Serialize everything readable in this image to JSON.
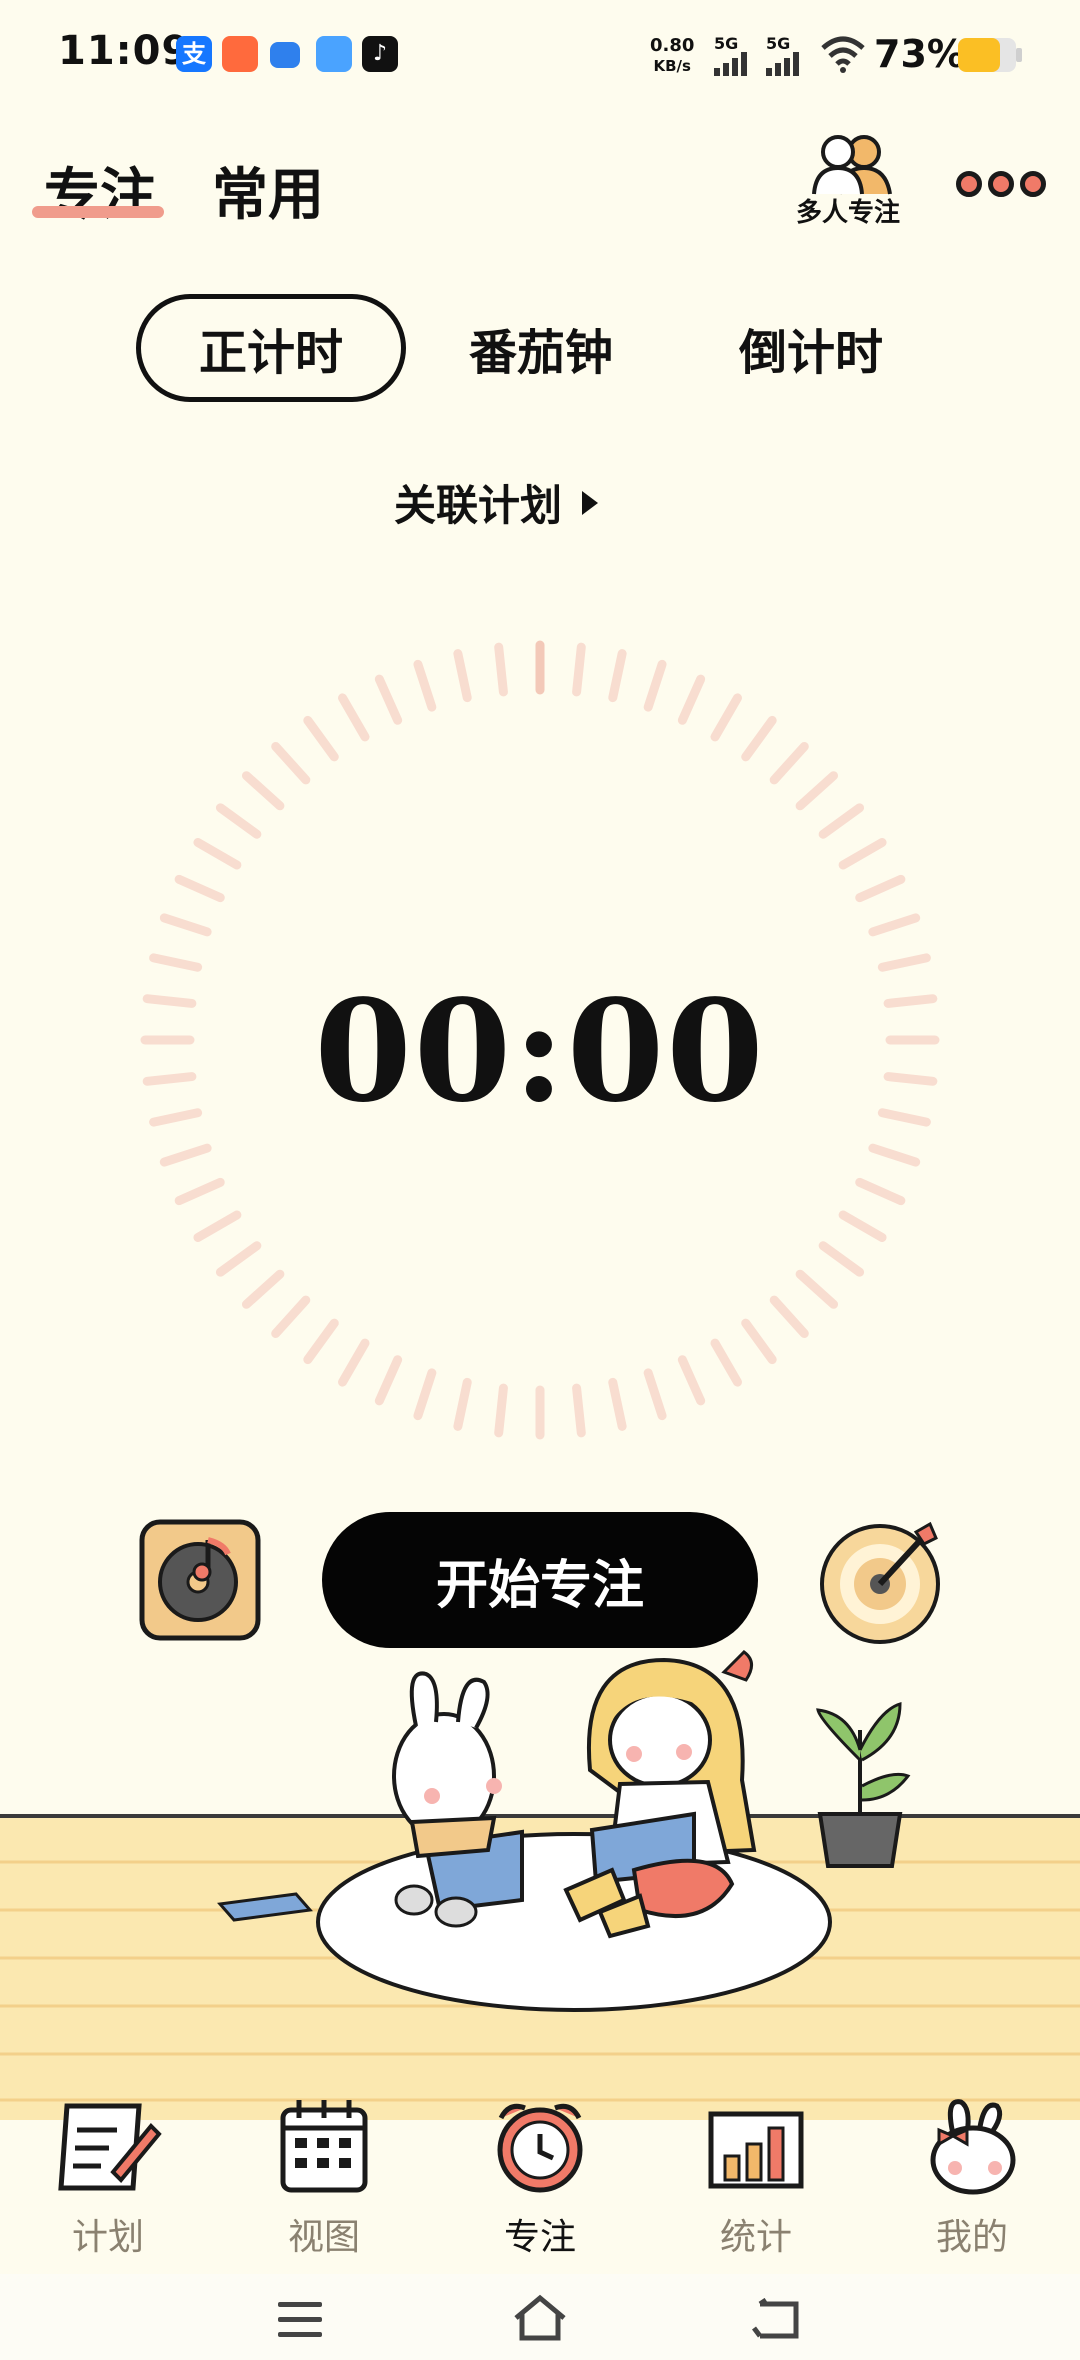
{
  "status_bar": {
    "time": "11:09",
    "net_speed_value": "0.80",
    "net_speed_unit": "KB/s",
    "signal_1": "5G",
    "signal_2": "5G",
    "battery": "73%",
    "icons": [
      "alipay-icon",
      "app-icon",
      "message-icon",
      "cloud-icon",
      "tiktok-icon"
    ]
  },
  "header": {
    "tab_focus": "专注",
    "tab_common": "常用",
    "multi_focus": "多人专注"
  },
  "modes": [
    "正计时",
    "番茄钟",
    "倒计时"
  ],
  "link_plan": "关联计划",
  "timer": "00:00",
  "start_button": "开始专注",
  "bottom_nav": [
    {
      "label": "计划",
      "icon": "notepad-icon"
    },
    {
      "label": "视图",
      "icon": "calendar-icon"
    },
    {
      "label": "专注",
      "icon": "alarm-clock-icon"
    },
    {
      "label": "统计",
      "icon": "bar-chart-icon"
    },
    {
      "label": "我的",
      "icon": "bunny-icon"
    }
  ],
  "colors": {
    "background": "#fefcee",
    "accent": "#f07a68",
    "tick": "#f8ddd0",
    "floor": "#fbe8b0"
  }
}
